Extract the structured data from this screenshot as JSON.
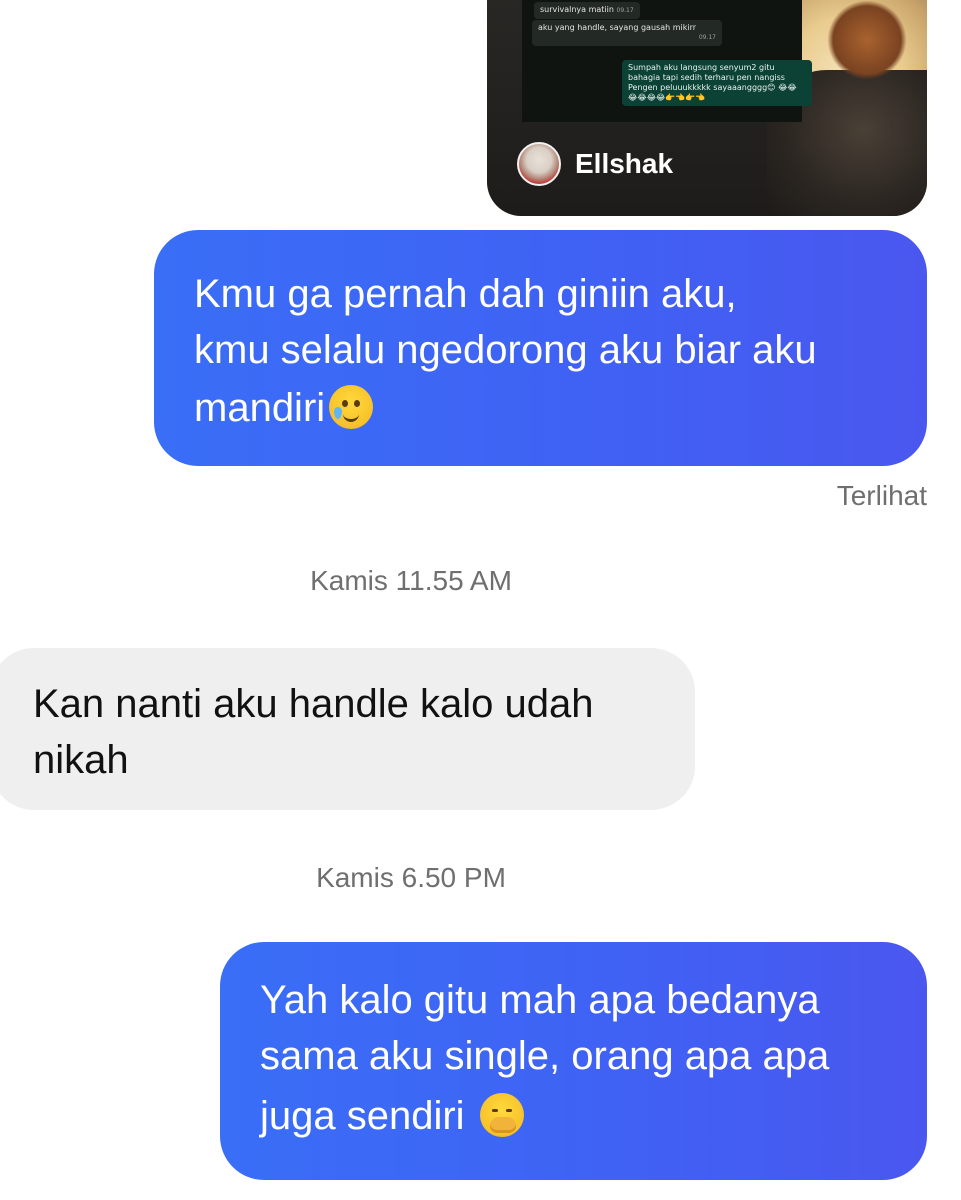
{
  "story": {
    "owner_name": "Ellshak",
    "screenshot_messages": [
      {
        "text": "survivalnya matiin",
        "time": "09.17",
        "direction": "incoming"
      },
      {
        "text": "aku yang handle, sayang gausah mikirr",
        "time": "09.17",
        "direction": "incoming"
      },
      {
        "text": "Sumpah aku langsung senyum2 gitu bahagia tapi sedih terharu pen nangiss Pengen peluuukkkkk sayaaangggg😊 😂😂😂😂😂😂👉👈👉👈",
        "direction": "outgoing"
      }
    ]
  },
  "messages": [
    {
      "type": "sent",
      "text": "Kmu ga pernah dah giniin aku, kmu selalu ngedorong aku biar aku mandiri",
      "line1": "Kmu ga pernah dah giniin aku,",
      "line2": "kmu selalu ngedorong aku biar aku",
      "line3": "mandiri",
      "emoji": "face-holding-back-tears-icon"
    },
    {
      "type": "status",
      "text": "Terlihat"
    },
    {
      "type": "timestamp",
      "text": "Kamis 11.55 AM"
    },
    {
      "type": "received",
      "text": "Kan nanti aku handle kalo udah nikah",
      "line1": "Kan nanti aku handle kalo udah",
      "line2": "nikah"
    },
    {
      "type": "timestamp",
      "text": "Kamis 6.50 PM"
    },
    {
      "type": "sent",
      "text": "Yah kalo gitu mah apa bedanya sama aku single, orang apa apa juga sendiri",
      "line1": "Yah kalo gitu mah apa bedanya",
      "line2": "sama aku single, orang apa apa",
      "line3": "juga sendiri",
      "emoji": "yawning-face-icon"
    }
  ],
  "colors": {
    "sent_bubble_start": "#3a6ef7",
    "sent_bubble_end": "#4a57ef",
    "received_bubble": "#efefef",
    "meta_text": "#6f6f6f"
  }
}
